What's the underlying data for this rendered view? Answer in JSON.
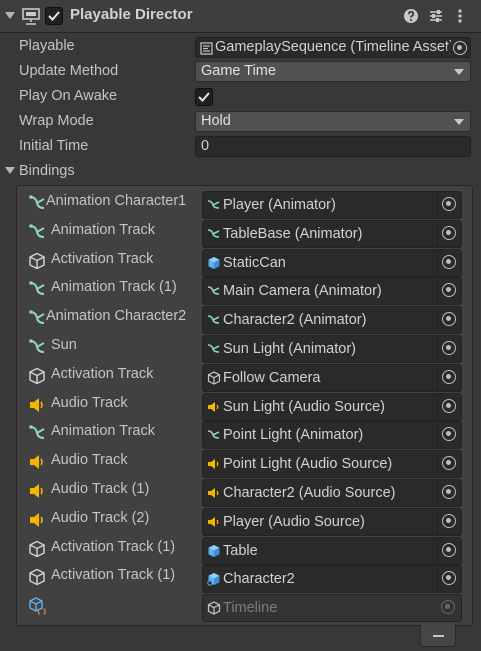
{
  "component": {
    "title": "Playable Director",
    "enabled": true
  },
  "properties": {
    "playable": {
      "label": "Playable",
      "value": "GameplaySequence (Timeline Asset)"
    },
    "update_method": {
      "label": "Update Method",
      "value": "Game Time"
    },
    "play_on_awake": {
      "label": "Play On Awake",
      "checked": true
    },
    "wrap_mode": {
      "label": "Wrap Mode",
      "value": "Hold"
    },
    "initial_time": {
      "label": "Initial Time",
      "value": "0"
    }
  },
  "bindings": {
    "label": "Bindings",
    "rows": [
      {
        "track": "Animation Character1",
        "track_icon": "animation-track-icon",
        "target": "Player (Animator)",
        "target_icon": "animator-icon"
      },
      {
        "track": "Animation Track",
        "track_icon": "animation-track-icon",
        "target": "TableBase (Animator)",
        "target_icon": "animator-icon"
      },
      {
        "track": "Activation Track",
        "track_icon": "activation-track-icon",
        "target": "StaticCan",
        "target_icon": "prefab-cube-icon"
      },
      {
        "track": "Animation Track (1)",
        "track_icon": "animation-track-icon",
        "target": "Main Camera (Animator)",
        "target_icon": "animator-icon"
      },
      {
        "track": "Animation Character2",
        "track_icon": "animation-track-icon",
        "target": "Character2 (Animator)",
        "target_icon": "animator-icon"
      },
      {
        "track": "Sun",
        "track_icon": "animation-track-icon",
        "target": "Sun Light (Animator)",
        "target_icon": "animator-icon"
      },
      {
        "track": "Activation Track",
        "track_icon": "activation-track-icon",
        "target": "Follow Camera",
        "target_icon": "gameobject-cube-icon"
      },
      {
        "track": "Audio Track",
        "track_icon": "audio-track-icon",
        "target": "Sun Light (Audio Source)",
        "target_icon": "audio-source-icon"
      },
      {
        "track": "Animation Track",
        "track_icon": "animation-track-icon",
        "target": "Point Light (Animator)",
        "target_icon": "animator-icon"
      },
      {
        "track": "Audio Track",
        "track_icon": "audio-track-icon",
        "target": "Point Light (Audio Source)",
        "target_icon": "audio-source-icon"
      },
      {
        "track": "Audio Track (1)",
        "track_icon": "audio-track-icon",
        "target": "Character2 (Audio Source)",
        "target_icon": "audio-source-icon"
      },
      {
        "track": "Audio Track (2)",
        "track_icon": "audio-track-icon",
        "target": "Player (Audio Source)",
        "target_icon": "audio-source-icon"
      },
      {
        "track": "Activation Track (1)",
        "track_icon": "activation-track-icon",
        "target": "Table",
        "target_icon": "prefab-cube-icon"
      },
      {
        "track": "Activation Track (1)",
        "track_icon": "activation-track-icon",
        "target": "Character2",
        "target_icon": "prefab-variant-icon"
      },
      {
        "track": "",
        "track_icon": "script-cube-icon",
        "target": "Timeline",
        "target_icon": "gameobject-cube-icon"
      }
    ]
  },
  "colors": {
    "animation_icon": "#8fd3c4",
    "audio_icon": "#f5b400",
    "prefab_icon": "#5fb2f5"
  }
}
